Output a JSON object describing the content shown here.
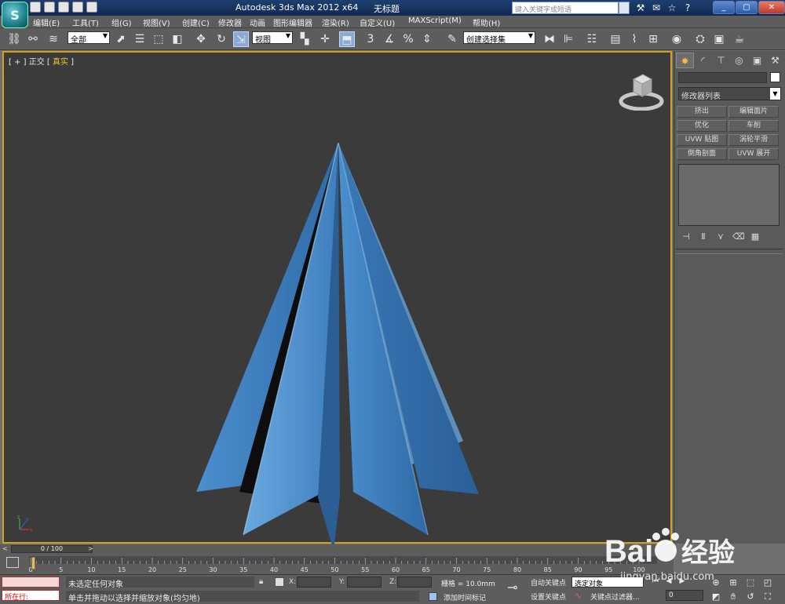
{
  "app": {
    "title": "Autodesk 3ds Max  2012 x64",
    "document": "无标题",
    "logo_letter": "S"
  },
  "search": {
    "placeholder": "键入关键字或短语"
  },
  "menu": [
    "编辑(E)",
    "工具(T)",
    "组(G)",
    "视图(V)",
    "创建(C)",
    "修改器",
    "动画",
    "图形编辑器",
    "渲染(R)",
    "自定义(U)",
    "MAXScript(M)",
    "帮助(H)"
  ],
  "toolbar": {
    "selection_filter": "全部",
    "ref_coord": "视图",
    "named_selection": "创建选择集"
  },
  "viewport": {
    "label_prefix": "[ + ] ",
    "view_name": "正交",
    "shading": "真实",
    "label_suffix": " ]"
  },
  "command_panel": {
    "modifier_list": "修改器列表",
    "modifier_buttons": [
      "挤出",
      "编辑面片",
      "优化",
      "车削",
      "UVW 贴图",
      "涡轮平滑",
      "倒角剖面",
      "UVW 展开"
    ]
  },
  "time_slider": {
    "frame": "0 / 100"
  },
  "track": {
    "ticks": [
      "0",
      "5",
      "10",
      "15",
      "20",
      "25",
      "30",
      "35",
      "40",
      "45",
      "50",
      "55",
      "60",
      "65",
      "70",
      "75",
      "80",
      "85",
      "90",
      "95",
      "100"
    ]
  },
  "status": {
    "run_now": "所在行:",
    "selection": "未选定任何对象",
    "prompt": "单击并拖动以选择并缩放对象(均匀地)",
    "x_label": "X:",
    "y_label": "Y:",
    "z_label": "Z:",
    "grid": "栅格 = 10.0mm",
    "add_time_tag": "添加时间标记",
    "auto_key": "自动关键点",
    "set_key": "设置关键点",
    "selection_set": "选定对象",
    "key_filters": "关键点过滤器...",
    "current_frame": "0"
  },
  "watermark": {
    "brand": "Bai",
    "brand2": "经验",
    "url": "jingyan.baidu.com"
  },
  "colors": {
    "object": "#3f7fbf",
    "viewport_bg": "#3b3b3b",
    "active_border": "#d4a017"
  }
}
